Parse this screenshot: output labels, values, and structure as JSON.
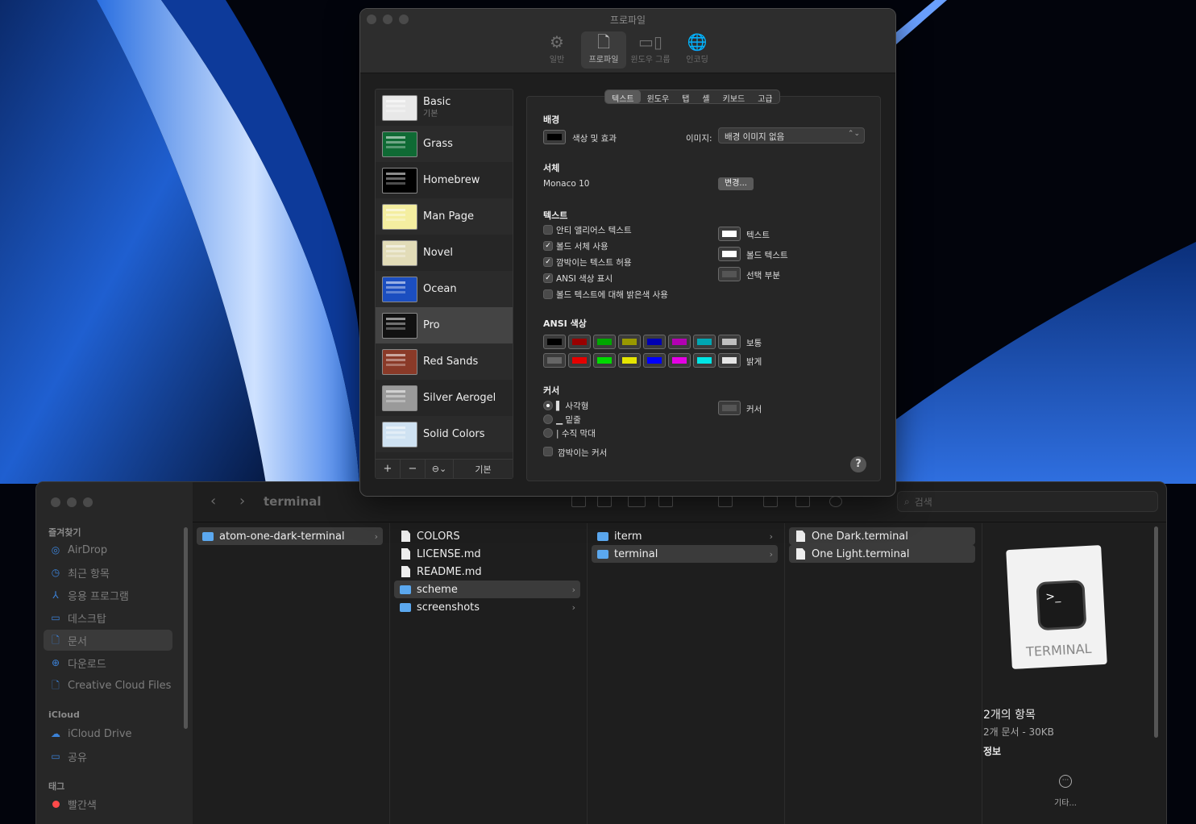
{
  "prefs": {
    "title": "프로파일",
    "toolbar": [
      {
        "label": "일반",
        "icon": "gear-icon",
        "glyph": "⚙"
      },
      {
        "label": "프로파일",
        "icon": "profile-icon",
        "glyph": "🗋",
        "selected": true
      },
      {
        "label": "윈도우 그룹",
        "icon": "window-group-icon",
        "glyph": "▭▯"
      },
      {
        "label": "인코딩",
        "icon": "globe-icon",
        "glyph": "🌐"
      }
    ],
    "profiles": [
      {
        "name": "Basic",
        "sub": "기본",
        "bg": "#e8e8e8",
        "fg": "#222"
      },
      {
        "name": "Grass",
        "sub": "",
        "bg": "#0f6a34",
        "fg": "#e8c040"
      },
      {
        "name": "Homebrew",
        "sub": "",
        "bg": "#000000",
        "fg": "#2ef52e"
      },
      {
        "name": "Man Page",
        "sub": "",
        "bg": "#f4eea0",
        "fg": "#333"
      },
      {
        "name": "Novel",
        "sub": "",
        "bg": "#e2dcb8",
        "fg": "#5a3c20"
      },
      {
        "name": "Ocean",
        "sub": "",
        "bg": "#1b4ec0",
        "fg": "#fff"
      },
      {
        "name": "Pro",
        "sub": "",
        "bg": "#111111",
        "fg": "#ddd"
      },
      {
        "name": "Red Sands",
        "sub": "",
        "bg": "#8a3a28",
        "fg": "#e8d4a0"
      },
      {
        "name": "Silver Aerogel",
        "sub": "",
        "bg": "#9a9a9a",
        "fg": "#222"
      },
      {
        "name": "Solid Colors",
        "sub": "",
        "bg": "#cfe2f2",
        "fg": "#223"
      }
    ],
    "list_buttons": {
      "add": "+",
      "remove": "−",
      "more": "⊖⌄",
      "default": "기본"
    },
    "tabs": [
      "텍스트",
      "윈도우",
      "탭",
      "셸",
      "키보드",
      "고급"
    ],
    "background": {
      "heading": "배경",
      "color_label": "색상 및 효과",
      "image_label": "이미지:",
      "image_value": "배경 이미지 없음"
    },
    "font": {
      "heading": "서체",
      "value": "Monaco 10",
      "change_button": "변경..."
    },
    "text": {
      "heading": "텍스트",
      "options": [
        {
          "label": "안티 앨리어스 텍스트",
          "checked": false
        },
        {
          "label": "볼드 서체 사용",
          "checked": true
        },
        {
          "label": "깜박이는 텍스트 허용",
          "checked": true
        },
        {
          "label": "ANSI 색상 표시",
          "checked": true
        },
        {
          "label": "볼드 텍스트에 대해 밝은색 사용",
          "checked": false
        }
      ],
      "swatches": [
        {
          "label": "텍스트",
          "color": "#ffffff"
        },
        {
          "label": "볼드 텍스트",
          "color": "#ffffff"
        },
        {
          "label": "선택 부분",
          "color": "#555555"
        }
      ]
    },
    "ansi": {
      "heading": "ANSI 색상",
      "normal_label": "보통",
      "bright_label": "밝게",
      "normal": [
        "#000000",
        "#990000",
        "#00a600",
        "#999900",
        "#0000b2",
        "#b200b2",
        "#00a6b2",
        "#bfbfbf"
      ],
      "bright": [
        "#666666",
        "#e50000",
        "#00d900",
        "#e5e500",
        "#0000ff",
        "#e500e5",
        "#00e5e5",
        "#e5e5e5"
      ]
    },
    "cursor": {
      "heading": "커서",
      "styles": [
        {
          "label": "▌ 사각형",
          "selected": true
        },
        {
          "label": "▁ 밑줄",
          "selected": false
        },
        {
          "label": "| 수직 막대",
          "selected": false
        }
      ],
      "blink_label": "깜박이는 커서",
      "swatch_label": "커서",
      "swatch_color": "#555555"
    },
    "help": "?"
  },
  "finder": {
    "sidebar": {
      "favorites_heading": "즐겨찾기",
      "favorites": [
        {
          "label": "AirDrop",
          "icon": "airdrop-icon",
          "glyph": "◎"
        },
        {
          "label": "최근 항목",
          "icon": "clock-icon",
          "glyph": "◷"
        },
        {
          "label": "응용 프로그램",
          "icon": "apps-icon",
          "glyph": "⅄"
        },
        {
          "label": "데스크탑",
          "icon": "desktop-icon",
          "glyph": "▭"
        },
        {
          "label": "문서",
          "icon": "document-icon",
          "glyph": "🗋",
          "selected": true
        },
        {
          "label": "다운로드",
          "icon": "download-icon",
          "glyph": "⊕"
        },
        {
          "label": "Creative Cloud Files",
          "icon": "file-icon",
          "glyph": "🗋"
        }
      ],
      "icloud_heading": "iCloud",
      "icloud": [
        {
          "label": "iCloud Drive",
          "icon": "cloud-icon",
          "glyph": "☁"
        },
        {
          "label": "공유",
          "icon": "shared-folder-icon",
          "glyph": "▭"
        }
      ],
      "tags_heading": "태그",
      "tags": [
        {
          "label": "빨간색",
          "color": "#ff4a4a"
        }
      ]
    },
    "title": "terminal",
    "search_placeholder": "검색",
    "columns": [
      [
        {
          "name": "atom-one-dark-terminal",
          "type": "folder",
          "selected": true,
          "chevron": true
        }
      ],
      [
        {
          "name": "COLORS",
          "type": "doc"
        },
        {
          "name": "LICENSE.md",
          "type": "doc"
        },
        {
          "name": "README.md",
          "type": "doc"
        },
        {
          "name": "scheme",
          "type": "folder",
          "selected": true,
          "chevron": true
        },
        {
          "name": "screenshots",
          "type": "folder",
          "chevron": true
        }
      ],
      [
        {
          "name": "iterm",
          "type": "folder",
          "chevron": true
        },
        {
          "name": "terminal",
          "type": "folder",
          "selected": true,
          "chevron": true
        }
      ],
      [
        {
          "name": "One Dark.terminal",
          "type": "doc",
          "selected": true
        },
        {
          "name": "One Light.terminal",
          "type": "doc",
          "selected": true
        }
      ]
    ],
    "preview": {
      "icon_text": "TERMINAL",
      "prompt": ">_",
      "count": "2개의 항목",
      "detail": "2개 문서 - 30KB",
      "info": "정보",
      "more": "기타..."
    }
  }
}
